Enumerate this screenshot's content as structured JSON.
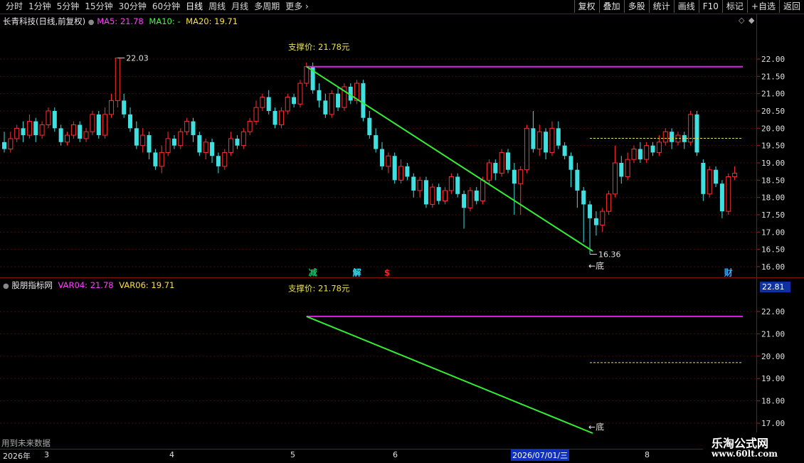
{
  "toolbar": {
    "periods": [
      "分时",
      "1分钟",
      "5分钟",
      "15分钟",
      "30分钟",
      "60分钟",
      "日线",
      "周线",
      "月线",
      "多周期",
      "更多"
    ],
    "active_period": "日线",
    "right_buttons": [
      "复权",
      "叠加",
      "多股",
      "统计",
      "画线",
      "F10",
      "标记",
      "+自选",
      "返回"
    ]
  },
  "main_pane": {
    "stock_title": "长青科技(日线,前复权)",
    "ma5_label": "MA5: 21.78",
    "ma10_label": "MA10: -",
    "ma20_label": "MA20: 19.71",
    "clipped_text": "支撑价: 21.78元",
    "high_label": "22.03",
    "low_label": "16.36",
    "low_tag": "←底",
    "y_ticks": [
      "22.00",
      "21.50",
      "21.00",
      "20.50",
      "20.00",
      "19.50",
      "19.00",
      "18.50",
      "18.00",
      "17.50",
      "17.00",
      "16.50",
      "16.00"
    ],
    "markers": [
      {
        "text": "减",
        "color": "#00cc66"
      },
      {
        "text": "解",
        "color": "#33e0ff"
      },
      {
        "text": "$",
        "color": "#ff2020"
      },
      {
        "text": "财",
        "color": "#33aaff"
      }
    ]
  },
  "sub_pane": {
    "title": "股朋指标网",
    "var04_label": "VAR04: 21.78",
    "var06_label": "VAR06: 19.71",
    "clipped_text": "支撑价: 21.78元",
    "current_value": "22.81",
    "low_tag": "←底",
    "y_ticks": [
      "22.00",
      "21.00",
      "20.00",
      "19.00",
      "18.00",
      "17.00"
    ],
    "footer_text": "用到未来数据"
  },
  "date_axis": {
    "year_label": "2026年",
    "months": [
      "3",
      "4",
      "5",
      "6",
      "8"
    ],
    "cursor_date": "2026/07/01/三"
  },
  "watermark": {
    "line1": "乐淘公式网",
    "line2": "www.60lt.com"
  },
  "colors": {
    "support_line": "#e020e0",
    "trend_line": "#33ee33",
    "up_candle": "#ff3030",
    "down_candle": "#40e0e0",
    "dashed_level": "#e8e050"
  },
  "chart_data": {
    "type": "candlestick",
    "ylim_main": [
      16.0,
      22.3
    ],
    "support_level": 21.78,
    "dashed_level": 19.71,
    "period_high": 22.03,
    "period_low": 16.36,
    "candles": [
      [
        19.6,
        19.4,
        19.9,
        19.3
      ],
      [
        19.4,
        19.7,
        19.9,
        19.3
      ],
      [
        19.7,
        20.0,
        20.1,
        19.6
      ],
      [
        20.0,
        19.8,
        20.2,
        19.6
      ],
      [
        19.8,
        20.2,
        20.4,
        19.7
      ],
      [
        20.2,
        19.8,
        20.3,
        19.6
      ],
      [
        19.8,
        20.1,
        20.2,
        19.7
      ],
      [
        20.1,
        20.5,
        20.6,
        20.0
      ],
      [
        20.5,
        20.0,
        20.6,
        19.9
      ],
      [
        20.0,
        19.6,
        20.1,
        19.5
      ],
      [
        19.6,
        19.8,
        19.9,
        19.5
      ],
      [
        19.8,
        20.1,
        20.2,
        19.7
      ],
      [
        20.1,
        19.7,
        20.2,
        19.6
      ],
      [
        19.7,
        19.9,
        20.0,
        19.6
      ],
      [
        19.9,
        20.4,
        20.5,
        19.8
      ],
      [
        20.4,
        19.8,
        20.5,
        19.7
      ],
      [
        19.8,
        20.4,
        20.6,
        19.7
      ],
      [
        20.4,
        20.8,
        21.0,
        20.3
      ],
      [
        20.8,
        22.03,
        22.03,
        20.6
      ],
      [
        20.8,
        20.4,
        21.0,
        20.3
      ],
      [
        20.4,
        20.0,
        20.6,
        19.9
      ],
      [
        20.0,
        19.5,
        20.2,
        19.4
      ],
      [
        19.5,
        19.8,
        20.0,
        19.3
      ],
      [
        19.8,
        19.3,
        19.9,
        19.1
      ],
      [
        19.3,
        18.9,
        19.4,
        18.8
      ],
      [
        18.9,
        19.3,
        19.5,
        18.7
      ],
      [
        19.3,
        19.7,
        19.9,
        19.2
      ],
      [
        19.7,
        19.5,
        19.8,
        19.4
      ],
      [
        19.5,
        19.9,
        20.0,
        19.4
      ],
      [
        19.9,
        20.2,
        20.3,
        19.8
      ],
      [
        20.2,
        19.8,
        20.3,
        19.6
      ],
      [
        19.8,
        19.3,
        19.9,
        19.2
      ],
      [
        19.3,
        19.6,
        19.7,
        19.1
      ],
      [
        19.6,
        19.2,
        19.7,
        19.0
      ],
      [
        19.2,
        18.9,
        19.3,
        18.7
      ],
      [
        18.9,
        19.3,
        19.4,
        18.8
      ],
      [
        19.3,
        19.7,
        19.9,
        19.2
      ],
      [
        19.7,
        19.5,
        19.8,
        19.4
      ],
      [
        19.5,
        19.9,
        20.0,
        19.4
      ],
      [
        19.9,
        20.2,
        20.3,
        19.8
      ],
      [
        20.2,
        20.6,
        20.8,
        20.1
      ],
      [
        20.6,
        20.9,
        21.0,
        20.5
      ],
      [
        20.9,
        20.5,
        21.1,
        20.4
      ],
      [
        20.5,
        20.1,
        20.6,
        20.0
      ],
      [
        20.1,
        20.5,
        20.6,
        20.0
      ],
      [
        20.5,
        20.9,
        21.0,
        20.4
      ],
      [
        20.9,
        20.7,
        21.0,
        20.6
      ],
      [
        20.7,
        21.3,
        21.4,
        20.6
      ],
      [
        21.3,
        21.78,
        21.9,
        21.2
      ],
      [
        21.78,
        21.1,
        21.9,
        21.0
      ],
      [
        21.1,
        20.8,
        21.3,
        20.6
      ],
      [
        20.8,
        20.4,
        21.0,
        20.3
      ],
      [
        20.4,
        21.0,
        21.1,
        20.3
      ],
      [
        21.0,
        20.6,
        21.2,
        20.5
      ],
      [
        20.6,
        21.2,
        21.3,
        20.5
      ],
      [
        21.2,
        20.8,
        21.3,
        20.7
      ],
      [
        20.8,
        21.3,
        21.4,
        20.7
      ],
      [
        21.3,
        20.3,
        21.4,
        20.2
      ],
      [
        20.3,
        19.8,
        20.5,
        19.7
      ],
      [
        19.8,
        19.4,
        20.0,
        19.3
      ],
      [
        19.4,
        18.9,
        19.6,
        18.8
      ],
      [
        18.9,
        19.2,
        19.3,
        18.7
      ],
      [
        19.2,
        18.5,
        19.3,
        18.4
      ],
      [
        18.5,
        18.9,
        19.1,
        18.4
      ],
      [
        18.9,
        18.6,
        19.0,
        18.5
      ],
      [
        18.6,
        18.2,
        18.7,
        18.0
      ],
      [
        18.2,
        18.5,
        18.6,
        18.0
      ],
      [
        18.5,
        17.8,
        18.6,
        17.7
      ],
      [
        17.8,
        18.3,
        18.4,
        17.7
      ],
      [
        18.3,
        17.9,
        18.4,
        17.8
      ],
      [
        17.9,
        18.2,
        18.3,
        17.8
      ],
      [
        18.2,
        18.6,
        18.7,
        18.1
      ],
      [
        18.6,
        18.1,
        18.7,
        18.0
      ],
      [
        18.1,
        17.7,
        18.2,
        17.1
      ],
      [
        17.7,
        18.2,
        18.3,
        17.6
      ],
      [
        18.2,
        17.9,
        18.3,
        17.8
      ],
      [
        17.9,
        18.5,
        18.6,
        17.8
      ],
      [
        18.5,
        19.0,
        19.1,
        18.4
      ],
      [
        19.0,
        18.7,
        19.1,
        18.5
      ],
      [
        18.7,
        19.3,
        19.4,
        18.6
      ],
      [
        19.3,
        18.8,
        19.4,
        18.7
      ],
      [
        18.8,
        18.4,
        19.0,
        17.5
      ],
      [
        18.4,
        18.8,
        18.9,
        17.5
      ],
      [
        18.8,
        20.0,
        20.1,
        18.7
      ],
      [
        20.0,
        19.4,
        20.5,
        19.3
      ],
      [
        19.4,
        19.9,
        20.1,
        19.2
      ],
      [
        19.9,
        19.3,
        20.0,
        19.1
      ],
      [
        19.3,
        20.0,
        20.2,
        19.2
      ],
      [
        20.0,
        19.5,
        20.2,
        19.4
      ],
      [
        19.5,
        19.2,
        19.6,
        19.1
      ],
      [
        19.2,
        18.8,
        19.3,
        18.3
      ],
      [
        18.8,
        18.2,
        19.0,
        17.7
      ],
      [
        18.2,
        17.8,
        18.3,
        16.7
      ],
      [
        17.8,
        17.4,
        17.9,
        16.36
      ],
      [
        17.4,
        17.2,
        17.6,
        16.9
      ],
      [
        17.2,
        17.6,
        17.7,
        17.0
      ],
      [
        17.6,
        18.1,
        18.2,
        17.5
      ],
      [
        18.1,
        19.0,
        19.5,
        18.0
      ],
      [
        19.0,
        18.6,
        19.2,
        18.4
      ],
      [
        18.6,
        19.1,
        19.3,
        18.5
      ],
      [
        19.1,
        19.4,
        19.5,
        19.0
      ],
      [
        19.4,
        19.1,
        19.6,
        19.0
      ],
      [
        19.1,
        19.5,
        19.6,
        19.0
      ],
      [
        19.5,
        19.3,
        19.6,
        19.2
      ],
      [
        19.3,
        19.6,
        19.8,
        19.2
      ],
      [
        19.6,
        19.9,
        20.0,
        19.5
      ],
      [
        19.9,
        19.6,
        20.0,
        19.4
      ],
      [
        19.6,
        19.8,
        19.9,
        19.5
      ],
      [
        19.8,
        19.6,
        19.9,
        19.4
      ],
      [
        19.6,
        20.4,
        20.5,
        19.5
      ],
      [
        20.4,
        19.3,
        20.5,
        19.2
      ],
      [
        19.0,
        18.1,
        19.1,
        17.9
      ],
      [
        18.1,
        18.8,
        18.9,
        18.0
      ],
      [
        18.8,
        18.4,
        18.9,
        18.3
      ],
      [
        18.4,
        17.6,
        18.5,
        17.4
      ],
      [
        17.6,
        18.6,
        18.7,
        17.5
      ],
      [
        18.6,
        18.7,
        18.9,
        18.5
      ]
    ]
  }
}
